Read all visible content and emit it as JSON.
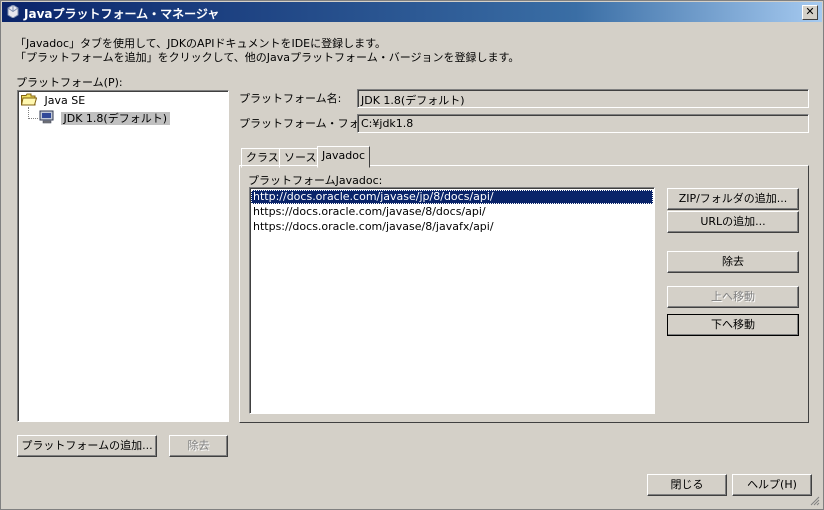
{
  "window": {
    "title": "Javaプラットフォーム・マネージャ",
    "close_glyph": "✕"
  },
  "info": {
    "line1": "「Javadoc」タブを使用して、JDKのAPIドキュメントをIDEに登録します。",
    "line2": "「プラットフォームを追加」をクリックして、他のJavaプラットフォーム・バージョンを登録します。"
  },
  "platforms": {
    "label": "プラットフォーム(P):",
    "tree": [
      {
        "label": "Java SE",
        "icon": "folder-open-icon"
      },
      {
        "label": "JDK 1.8(デフォルト)",
        "icon": "computer-icon"
      }
    ]
  },
  "details": {
    "name_label": "プラットフォーム名:",
    "name_value": "JDK 1.8(デフォルト)",
    "folder_label": "プラットフォーム・フォルダ:",
    "folder_value": "C:¥jdk1.8"
  },
  "tabs": [
    {
      "label": "クラス"
    },
    {
      "label": "ソース"
    },
    {
      "label": "Javadoc",
      "active": true
    }
  ],
  "javadoc": {
    "list_label": "プラットフォームJavadoc:",
    "items": [
      "http://docs.oracle.com/javase/jp/8/docs/api/",
      "https://docs.oracle.com/javase/8/docs/api/",
      "https://docs.oracle.com/javase/8/javafx/api/"
    ],
    "selected_index": 0,
    "buttons": {
      "add_zip": "ZIP/フォルダの追加...",
      "add_url": "URLの追加...",
      "remove": "除去",
      "move_up": "上へ移動",
      "move_down": "下へ移動"
    }
  },
  "bottom": {
    "add_platform": "プラットフォームの追加...",
    "remove": "除去",
    "close": "閉じる",
    "help": "ヘルプ(H)"
  },
  "colors": {
    "title_start": "#0a246a",
    "title_end": "#a6caf0",
    "selection": "#0a246a",
    "face": "#d4d0c8"
  }
}
